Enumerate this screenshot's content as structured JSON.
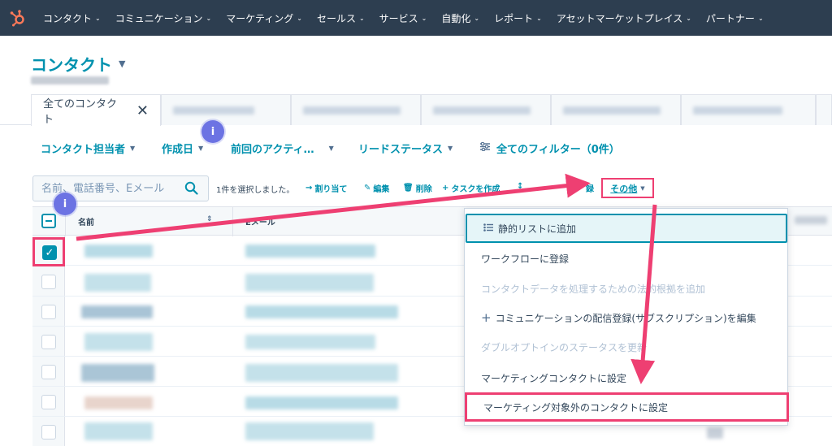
{
  "nav": {
    "items": [
      {
        "label": "コンタクト"
      },
      {
        "label": "コミュニケーション"
      },
      {
        "label": "マーケティング"
      },
      {
        "label": "セールス"
      },
      {
        "label": "サービス"
      },
      {
        "label": "自動化"
      },
      {
        "label": "レポート"
      },
      {
        "label": "アセットマーケットプレイス"
      },
      {
        "label": "パートナー"
      }
    ]
  },
  "header": {
    "title": "コンタクト"
  },
  "tabs": {
    "active_label": "全てのコンタクト"
  },
  "filters": {
    "owner": "コンタクト担当者",
    "created": "作成日",
    "last_activity": "前回のアクティ…",
    "lead_status": "リードステータス",
    "all_filters": "全てのフィルター（0件）"
  },
  "badge": {
    "info": "i"
  },
  "toolbar": {
    "search_placeholder": "名前、電話番号、Eメール",
    "selected_text": "1件を選択しました。",
    "assign": "割り当て",
    "edit": "編集",
    "delete": "削除",
    "create_task": "タスクを作成",
    "enroll_partial": "録",
    "more": "その他"
  },
  "table": {
    "col_name": "名前",
    "col_email": "Eメール"
  },
  "dropdown": {
    "items": [
      {
        "label": "静的リストに追加"
      },
      {
        "label": "ワークフローに登録"
      },
      {
        "label": "コンタクトデータを処理するための法的根拠を追加"
      },
      {
        "label": "コミュニケーションの配信登録(サブスクリプション)を編集"
      },
      {
        "label": "ダブルオプトインのステータスを更新"
      },
      {
        "label": "マーケティングコンタクトに設定"
      },
      {
        "label": "マーケティング対象外のコンタクトに設定"
      }
    ]
  },
  "colors": {
    "nav_bg": "#2d3e50",
    "brand_orange": "#ff7a59",
    "link_teal": "#0091ae",
    "highlight_pink": "#ee3f72",
    "info_badge": "#6c73e3"
  },
  "icons": [
    "hubspot-logo-icon",
    "chevron-down-icon",
    "close-icon",
    "search-icon",
    "filter-icon",
    "arrow-right-icon",
    "pencil-icon",
    "trash-icon",
    "plus-icon",
    "list-icon",
    "check-icon",
    "minus-icon"
  ]
}
